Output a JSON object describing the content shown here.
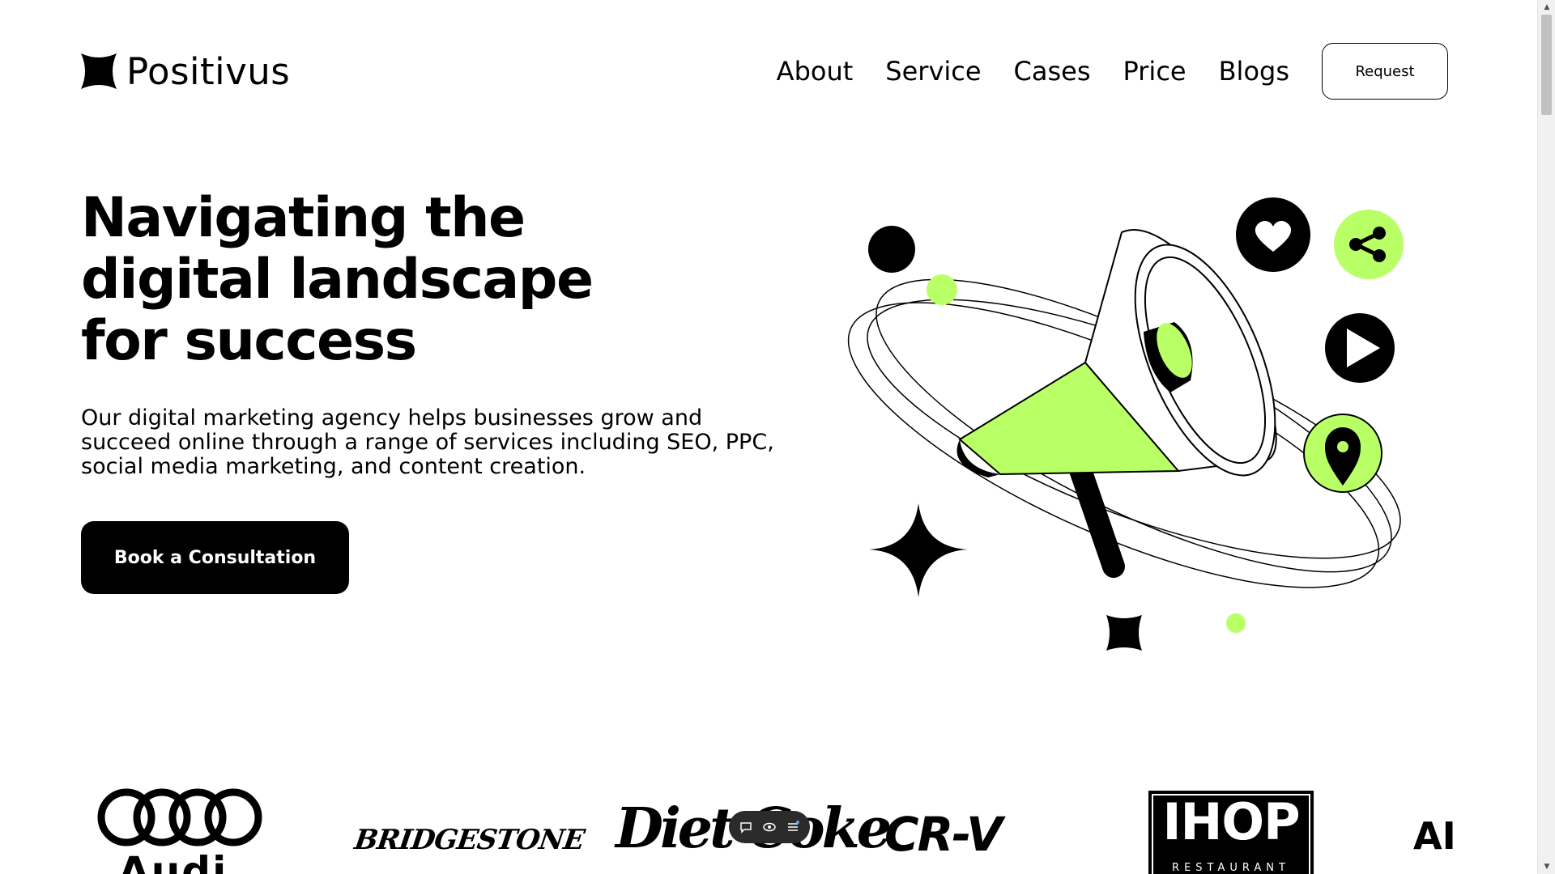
{
  "brand": {
    "name": "Positivus",
    "accent": "#B9FF66",
    "dark": "#000000"
  },
  "nav": {
    "links": [
      "About",
      "Service",
      "Cases",
      "Price",
      "Blogs"
    ],
    "cta": "Request"
  },
  "hero": {
    "title_lines": [
      "Navigating the",
      "digital landscape",
      "for success"
    ],
    "description": "Our digital marketing agency helps businesses grow and succeed online through a range of services including SEO, PPC, social media marketing, and content creation.",
    "cta": "Book a Consultation",
    "illustration_icons": [
      "megaphone-icon",
      "heart-icon",
      "share-icon",
      "play-icon",
      "location-pin-icon",
      "sparkle-star-icon"
    ]
  },
  "logos": {
    "audi": "Audi",
    "bridgestone": "BRIDGESTONE",
    "dietcoke": "Diet Coke",
    "crv": "CR-V",
    "ihop": "IHOP",
    "ihop_sub": "RESTAURANT",
    "partial": "AI"
  },
  "toolbar": {
    "icons": [
      "chat-icon",
      "eye-icon",
      "menu-icon"
    ]
  }
}
